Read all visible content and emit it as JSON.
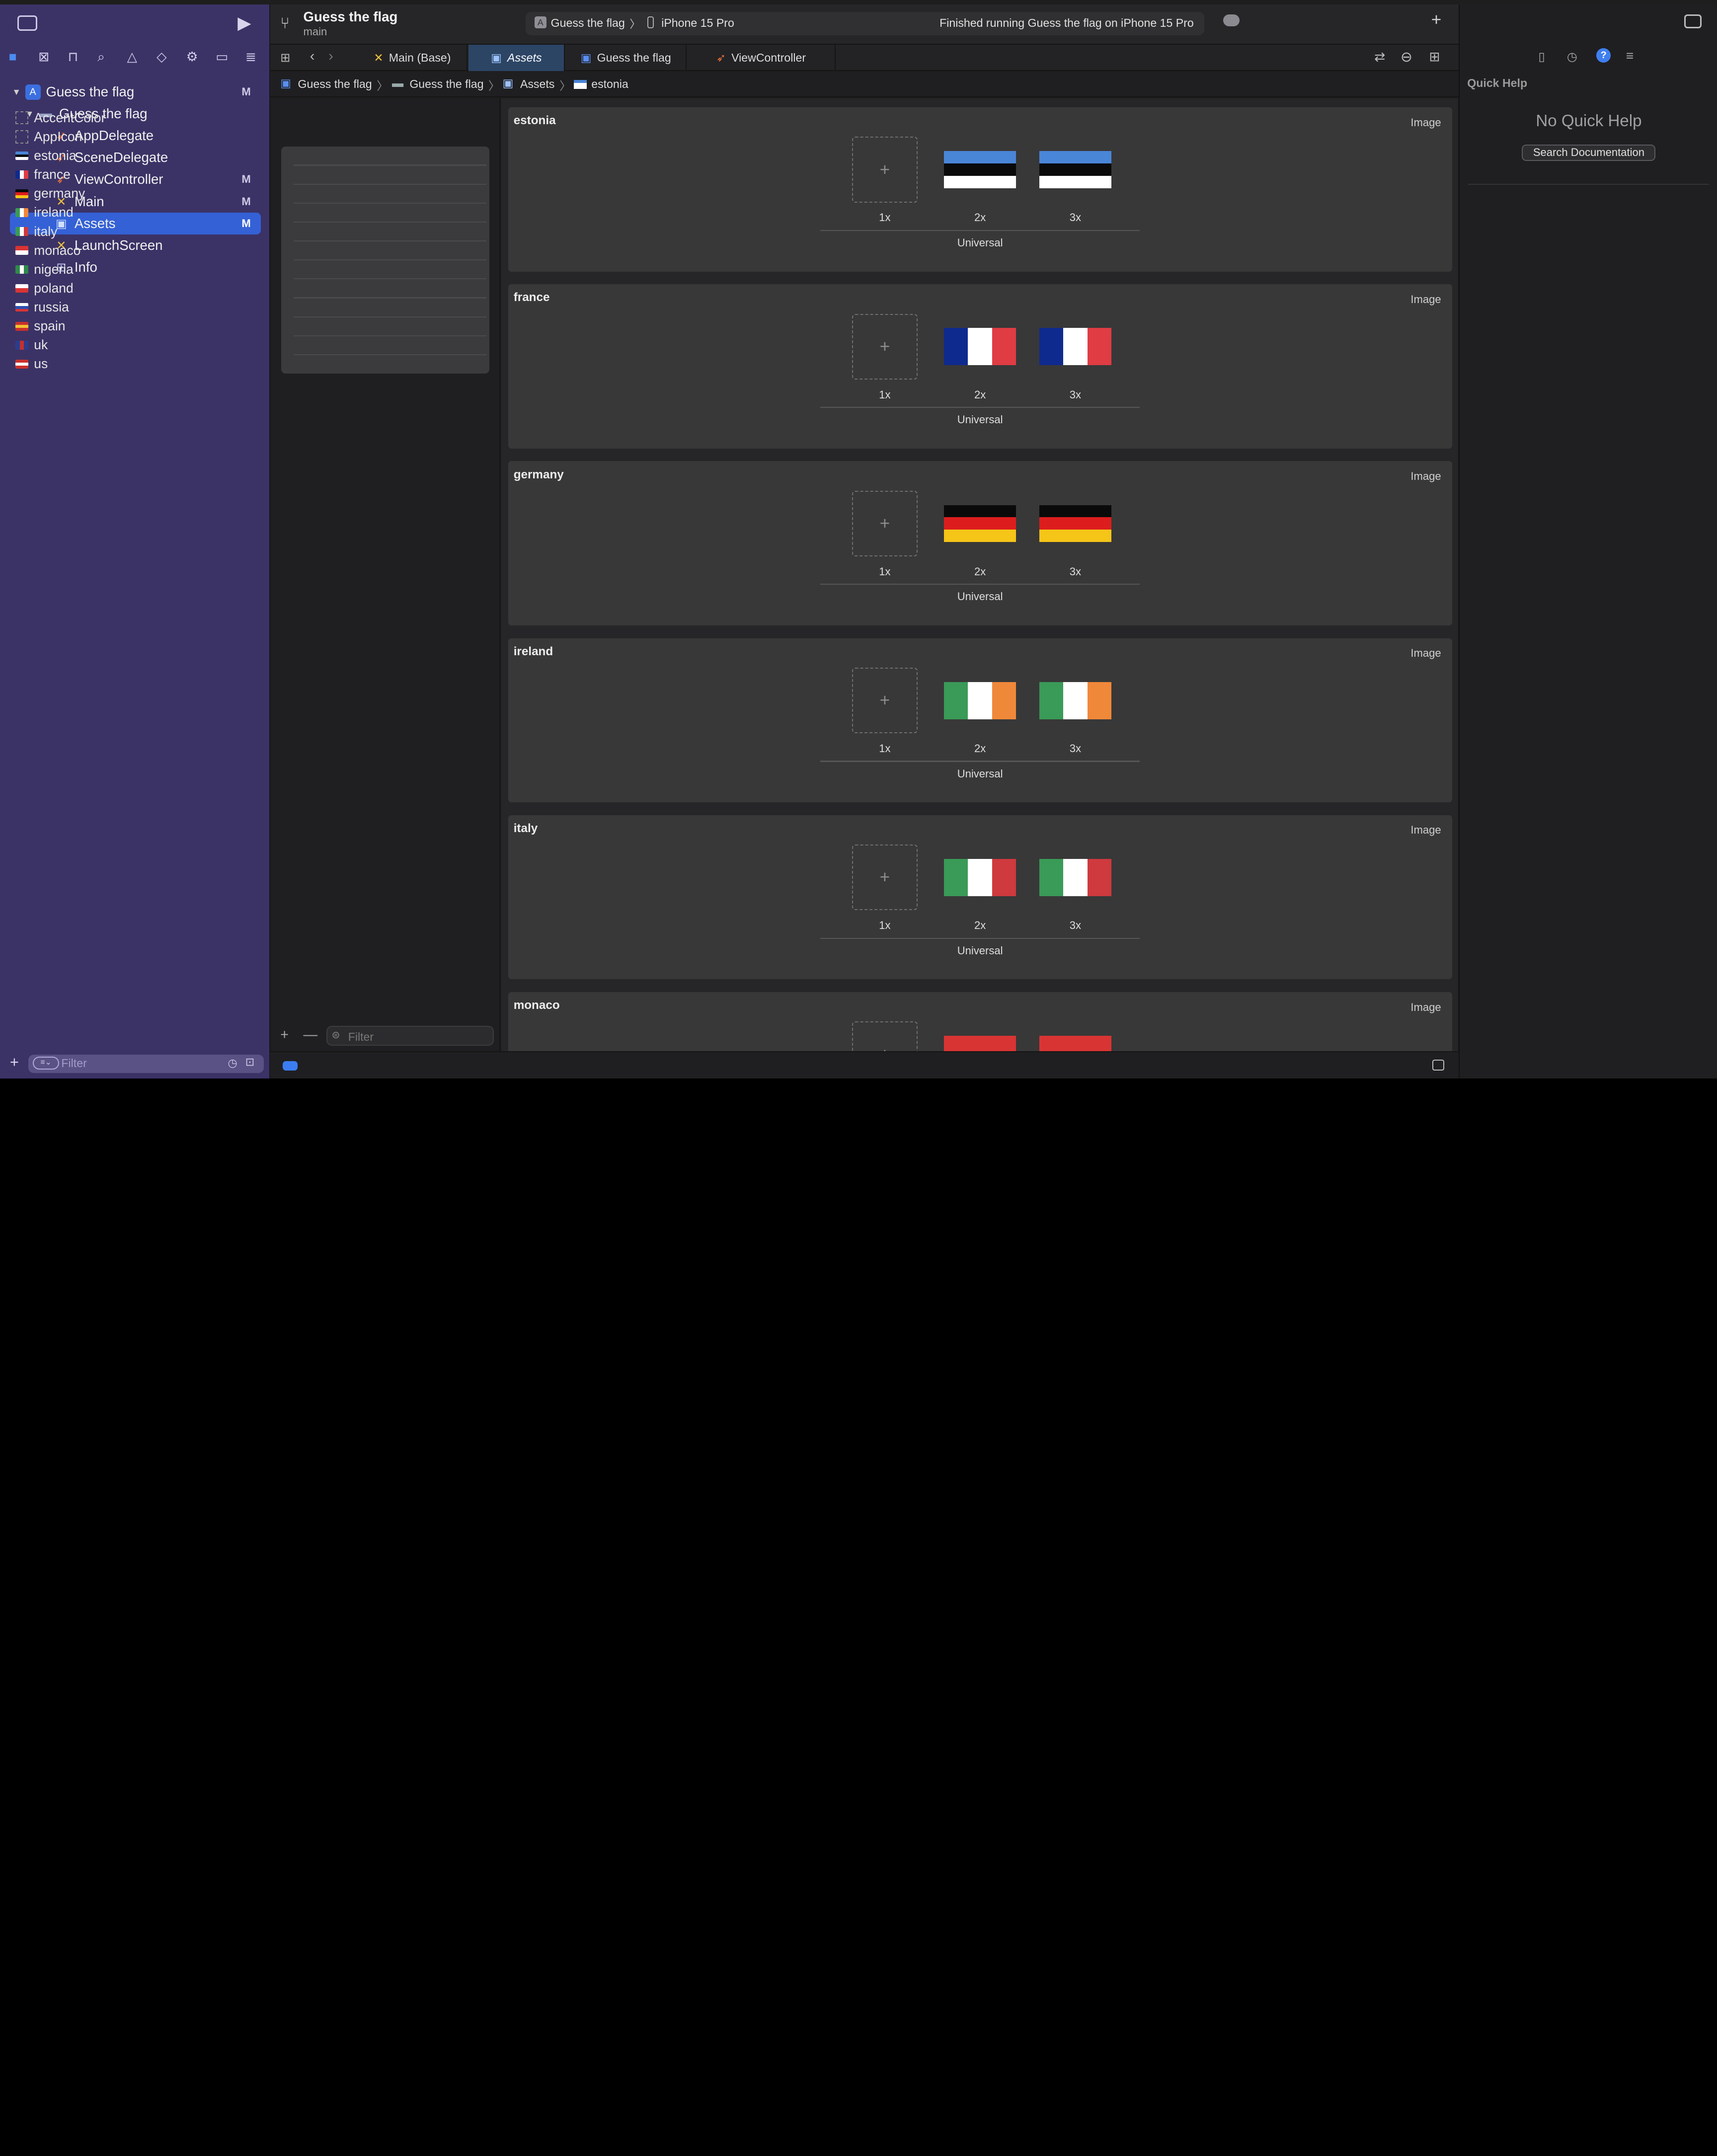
{
  "window": {
    "project_title": "Guess the flag",
    "branch": "main",
    "scheme": "Guess the flag",
    "device": "iPhone 15 Pro",
    "status": "Finished running Guess the flag on iPhone 15 Pro"
  },
  "navigator": {
    "items": [
      {
        "label": "Guess the flag",
        "badge": "M",
        "icon": "project-icon"
      },
      {
        "label": "Guess the flag",
        "badge": "",
        "icon": "folder-icon"
      },
      {
        "label": "AppDelegate",
        "badge": "",
        "icon": "swift-file-icon"
      },
      {
        "label": "SceneDelegate",
        "badge": "",
        "icon": "swift-file-icon"
      },
      {
        "label": "ViewController",
        "badge": "M",
        "icon": "swift-file-icon"
      },
      {
        "label": "Main",
        "badge": "M",
        "icon": "storyboard-icon"
      },
      {
        "label": "Assets",
        "badge": "M",
        "icon": "asset-catalog-icon"
      },
      {
        "label": "LaunchScreen",
        "badge": "",
        "icon": "storyboard-icon"
      },
      {
        "label": "Info",
        "badge": "",
        "icon": "plist-icon"
      }
    ],
    "filter_placeholder": "Filter"
  },
  "tabs": [
    {
      "label": "Main (Base)"
    },
    {
      "label": "Assets"
    },
    {
      "label": "Guess the flag"
    },
    {
      "label": "ViewController"
    }
  ],
  "breadcrumb": [
    "Guess the flag",
    "Guess the flag",
    "Assets",
    "estonia"
  ],
  "asset_list": {
    "items": [
      "AccentColor",
      "AppIcon",
      "estonia",
      "france",
      "germany",
      "ireland",
      "italy",
      "monaco",
      "nigeria",
      "poland",
      "russia",
      "spain",
      "uk",
      "us"
    ],
    "filter_placeholder": "Filter"
  },
  "assets": {
    "type_label": "Image",
    "scale_labels": [
      "1x",
      "2x",
      "3x"
    ],
    "device_label": "Universal",
    "sets": [
      {
        "name": "estonia",
        "colors": [
          "#4a86d8",
          "#0a0a0a",
          "#ffffff"
        ],
        "orient": "h"
      },
      {
        "name": "france",
        "colors": [
          "#0e2a8e",
          "#ffffff",
          "#e03c44"
        ],
        "orient": "v"
      },
      {
        "name": "germany",
        "colors": [
          "#0a0a0a",
          "#dd1d1d",
          "#f5c518"
        ],
        "orient": "h"
      },
      {
        "name": "ireland",
        "colors": [
          "#3a9a57",
          "#ffffff",
          "#f0883a"
        ],
        "orient": "v"
      },
      {
        "name": "italy",
        "colors": [
          "#3a9a57",
          "#ffffff",
          "#ce3a3e"
        ],
        "orient": "v"
      },
      {
        "name": "monaco",
        "colors": [
          "#d93434",
          "#ffffff"
        ],
        "orient": "h"
      }
    ]
  },
  "inspector": {
    "title": "Quick Help",
    "empty": "No Quick Help",
    "button": "Search Documentation"
  }
}
